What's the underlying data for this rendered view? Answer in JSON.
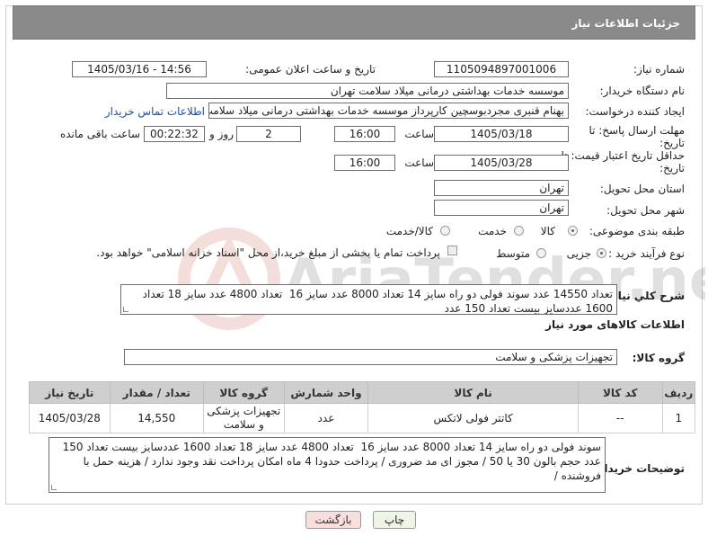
{
  "header": {
    "title": "جزئیات اطلاعات نیاز"
  },
  "labels": {
    "need_number": "شماره نیاز:",
    "announce_datetime": "تاریخ و ساعت اعلان عمومی:",
    "buyer_org": "نام دستگاه خریدار:",
    "requester": "ایجاد کننده درخواست:",
    "reply_deadline": "مهلت ارسال پاسخ: تا تاریخ:",
    "price_validity": "حداقل تاریخ اعتبار قیمت: تا تاریخ:",
    "delivery_province": "استان محل تحویل:",
    "delivery_city": "شهر محل تحویل:",
    "category": "طبقه بندی موضوعی:",
    "purchase_type": "نوع فرآیند خرید :",
    "time": "ساعت",
    "day_and": "روز و",
    "remaining": "ساعت باقی مانده",
    "need_desc": "شرح کلي نياز:",
    "goods_info": "اطلاعات کالاهای مورد نیاز",
    "goods_group": "گروه کالا:",
    "buyer_notes": "توضیحات خریدار:"
  },
  "fields": {
    "need_number": "1105094897001006",
    "announce_datetime": "1405/03/16 - 14:56",
    "buyer_org": "موسسه خدمات بهداشتی درمانی میلاد سلامت تهران",
    "requester": "بهنام قنبری مجردبوسچین کارپرداز موسسه خدمات بهداشتی درمانی میلاد سلامت تهران",
    "contact_link": "اطلاعات تماس خریدار",
    "reply_date": "1405/03/18",
    "reply_time": "16:00",
    "reply_days": "2",
    "reply_remaining": "00:22:32",
    "validity_date": "1405/03/28",
    "validity_time": "16:00",
    "province": "تهران",
    "city": "تهران",
    "goods_group": "تجهیزات پزشکی و سلامت"
  },
  "category_options": [
    {
      "label": "کالا",
      "selected": true
    },
    {
      "label": "خدمت",
      "selected": false
    },
    {
      "label": "کالا/خدمت",
      "selected": false
    }
  ],
  "purchase_options": [
    {
      "label": "جزیی",
      "selected": true
    },
    {
      "label": "متوسط",
      "selected": false
    }
  ],
  "payment_note": "پرداخت تمام یا بخشی از مبلغ خرید،از محل \"اسناد خزانه اسلامی\" خواهد بود.",
  "need_description": "تعداد 14550 عدد سوند فولی دو راه سایز 14 تعداد 8000 عدد سایز 16  تعداد 4800 عدد سایز 18 تعداد 1600 عددسایز بیست تعداد 150 عدد",
  "table": {
    "headers": [
      "ردیف",
      "کد کالا",
      "نام کالا",
      "واحد شمارش",
      "گروه کالا",
      "تعداد / مقدار",
      "تاریخ نیاز"
    ],
    "rows": [
      [
        "1",
        "--",
        "کاتتر فولی لاتکس",
        "عدد",
        "تجهیزات پزشکی و سلامت",
        "14,550",
        "1405/03/28"
      ]
    ]
  },
  "buyer_notes": "سوند فولی دو راه سایز 14 تعداد 8000 عدد سایز 16  تعداد 4800 عدد سایز 18 تعداد 1600 عددسایز بیست تعداد 150 عدد حجم بالون 30 یا 50 / مجوز ای مد ضروری / پرداخت حدودا 4 ماه امکان پرداخت نقد وجود ندارد / هزینه حمل با فروشنده /",
  "buttons": {
    "print": "چاپ",
    "back": "بازگشت"
  },
  "watermark": "AriaTender.net",
  "colors": {
    "header_bg": "#8a8a8a",
    "link": "#1a4fa3",
    "back_btn_bg": "#f9dede",
    "print_btn_bg": "#eef5e6"
  }
}
